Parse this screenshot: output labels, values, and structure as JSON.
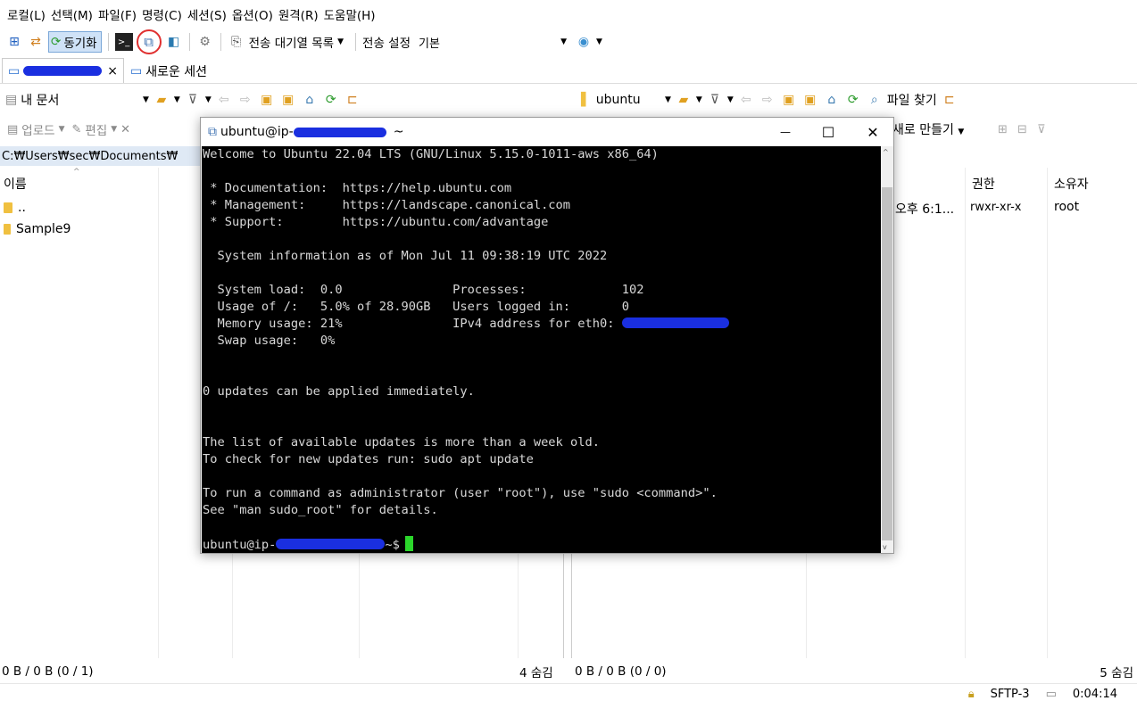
{
  "menubar": {
    "items": [
      "로컬(L)",
      "선택(M)",
      "파일(F)",
      "명령(C)",
      "세션(S)",
      "옵션(O)",
      "원격(R)",
      "도움말(H)"
    ]
  },
  "toolbar": {
    "sync_label": "동기화",
    "queue_label": "전송 대기열 목록",
    "transfer_settings_label": "전송 설정",
    "transfer_settings_value": "기본"
  },
  "tabs": {
    "new_session_label": "새로운 세션",
    "close_glyph": "×"
  },
  "left": {
    "location": "내 문서",
    "address": "C:₩Users₩sec₩Documents₩",
    "col_name": "이름",
    "rows": [
      {
        "name": ".."
      },
      {
        "name": "Sample9"
      }
    ],
    "status": "0 B / 0 B (0 / 1)",
    "hidden": "4 숨김"
  },
  "actions": {
    "upload_label": "업로드",
    "edit_label": "편집"
  },
  "right": {
    "location": "ubuntu",
    "find_label": "파일 찾기",
    "new_label": "새로 만들기",
    "col_perm": "권한",
    "col_owner": "소유자",
    "row": {
      "date": "오후 6:1...",
      "perm": "rwxr-xr-x",
      "owner": "root"
    },
    "status": "0 B / 0 B (0 / 0)",
    "hidden": "5 숨김"
  },
  "bottom": {
    "protocol": "SFTP-3",
    "elapsed": "0:04:14"
  },
  "terminal": {
    "title_prefix": "ubuntu@ip-",
    "title_suffix": "~",
    "minimize_glyph": "—",
    "maximize_glyph": "☐",
    "close_glyph": "✕",
    "lines": [
      "Welcome to Ubuntu 22.04 LTS (GNU/Linux 5.15.0-1011-aws x86_64)",
      "",
      " * Documentation:  https://help.ubuntu.com",
      " * Management:     https://landscape.canonical.com",
      " * Support:        https://ubuntu.com/advantage",
      "",
      "  System information as of Mon Jul 11 09:38:19 UTC 2022",
      "",
      "  System load:  0.0               Processes:             102",
      "  Usage of /:   5.0% of 28.90GB   Users logged in:       0"
    ],
    "mem_line": "  Memory usage: 21%               IPv4 address for eth0: ",
    "lines2": [
      "  Swap usage:   0%",
      "",
      "",
      "0 updates can be applied immediately.",
      "",
      "",
      "The list of available updates is more than a week old.",
      "To check for new updates run: sudo apt update",
      "",
      "To run a command as administrator (user \"root\"), use \"sudo <command>\".",
      "See \"man sudo_root\" for details.",
      ""
    ],
    "prompt_prefix": "ubuntu@ip-",
    "prompt_suffix": "~$"
  }
}
